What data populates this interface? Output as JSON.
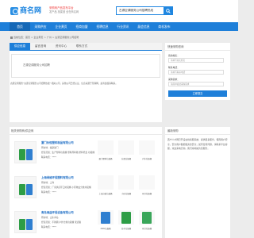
{
  "header": {
    "logo_text": "商名网",
    "logo_sub": "Shangming Network",
    "slogan_1": "采购商产品发布平台",
    "slogan_2": "发产品 找渠道 全在商名网",
    "search_placeholder": "古源空调服务公司招聘热线"
  },
  "nav": [
    "首页",
    "采购供应",
    "企业黄页",
    "招商加盟",
    "招聘信息",
    "行业资讯",
    "展会信息",
    "商机发布"
  ],
  "breadcrumb": "当前位置：首页 > 企业黄页 > 广州 > 古源空调服务公司招聘",
  "tabs": [
    "供应信息",
    "留言咨询",
    "资讯中心",
    "联系方式"
  ],
  "company": {
    "name": "古源空调服务公司招聘",
    "notice": "古源空调服务\"古源空调服务公司招聘热线\" 相关公司，其他公司已经认证。信息来源于互联网，如有侵权请联系。"
  },
  "list": {
    "title": "相关采购商/供应商",
    "items": [
      {
        "title": "厦门永恒塑料制品有限公司",
        "l1": "所在地：福建厦门",
        "l2": "经营范围：生产塑料垃圾桶 塑料周转箱 塑料托盘 垃圾桶",
        "l3": "联系电话：****",
        "p1": "厦门塑料垃圾桶",
        "p2": "分类垃圾桶",
        "p3": "户外垃圾桶"
      },
      {
        "title": "上海绿维环保塑料有限公司",
        "l1": "所在地：上海",
        "l2": "经营范围：厂家供应环卫垃圾桶 小区物业分类垃圾桶",
        "l3": "联系电话：****",
        "p1": "上海分类垃圾桶",
        "p2": "小区垃圾桶",
        "p3": "环卫垃圾桶"
      },
      {
        "title": "青岛海益环保设备有限公司",
        "l1": "所在地：山东青岛",
        "l2": "经营范围：不锈钢 户外分类垃圾桶 果皮箱",
        "l3": "联系电话：****",
        "p1": "240L垃圾桶",
        "p2": "挂车垃圾桶",
        "p3": "环卫垃圾桶"
      }
    ]
  },
  "sidebar": {
    "form_title": "快速采购咨询",
    "name_label": "您的姓名：",
    "name_placeholder": "请填写真实姓名",
    "phone_label": "联系电话：",
    "phone_placeholder": "请填写联系电话",
    "need_label": "采购需求：",
    "need_placeholder": "请简单描述采购需求",
    "submit": "立即提交",
    "info_title": "最新采购",
    "info_text": "西宁人才网已开设在线客服系统，提供更多服务，保障用户安全，安全用户数据和资金安全；如有任何问题，请联系平台客服，欢迎来电咨询，我们将竭诚为您服务。"
  }
}
